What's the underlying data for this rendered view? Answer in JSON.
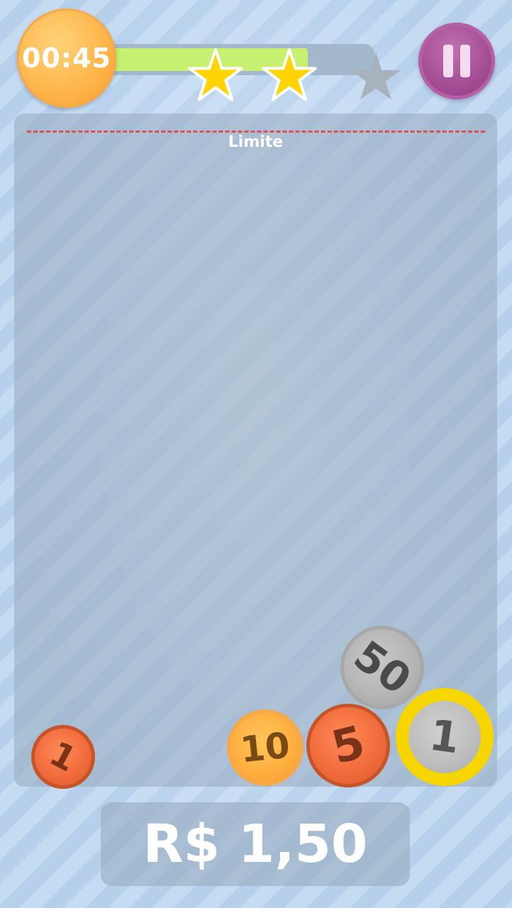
{
  "hud": {
    "timer": "00:45",
    "progress_fraction": 0.75,
    "stars_earned": 2,
    "stars_total": 3,
    "colors": {
      "star_filled": "#FFD400",
      "star_empty": "#A7B2BC",
      "progress_fill": "#C6F06F"
    }
  },
  "play_area": {
    "limit_label": "Limite"
  },
  "coins": [
    {
      "label": "1",
      "type": "copper"
    },
    {
      "label": "10",
      "type": "gold"
    },
    {
      "label": "5",
      "type": "copper"
    },
    {
      "label": "50",
      "type": "silver"
    },
    {
      "label": "1",
      "type": "real"
    }
  ],
  "total": {
    "label": "R$ 1,50"
  }
}
